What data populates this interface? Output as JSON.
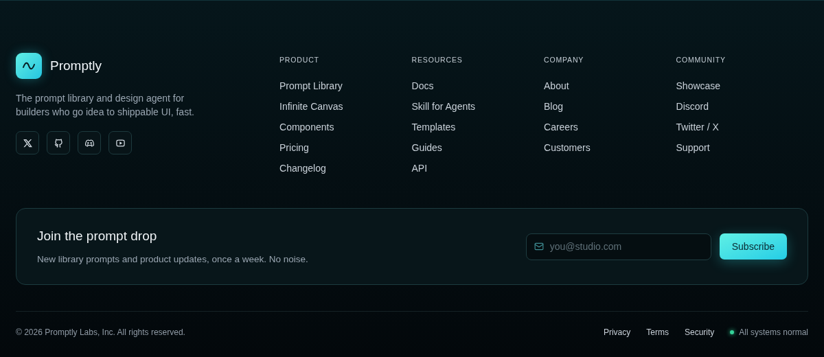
{
  "brand": {
    "name": "Promptly",
    "tagline": "The prompt library and design agent for builders who go idea to shippable UI, fast."
  },
  "socials": [
    {
      "kind": "x"
    },
    {
      "kind": "github"
    },
    {
      "kind": "discord"
    },
    {
      "kind": "youtube"
    }
  ],
  "columns": [
    {
      "title": "PRODUCT",
      "links": [
        "Prompt Library",
        "Infinite Canvas",
        "Components",
        "Pricing",
        "Changelog"
      ]
    },
    {
      "title": "RESOURCES",
      "links": [
        "Docs",
        "Skill for Agents",
        "Templates",
        "Guides",
        "API"
      ]
    },
    {
      "title": "COMPANY",
      "links": [
        "About",
        "Blog",
        "Careers",
        "Customers"
      ]
    },
    {
      "title": "COMMUNITY",
      "links": [
        "Showcase",
        "Discord",
        "Twitter / X",
        "Support"
      ]
    }
  ],
  "newsletter": {
    "title": "Join the prompt drop",
    "subtitle": "New library prompts and product updates, once a week. No noise.",
    "placeholder": "you@studio.com",
    "button": "Subscribe"
  },
  "bottom": {
    "copyright": "© 2026 Promptly Labs, Inc. All rights reserved.",
    "links": [
      "Privacy",
      "Terms",
      "Security"
    ],
    "status": {
      "label": "All systems normal",
      "color": "#34d399"
    }
  }
}
